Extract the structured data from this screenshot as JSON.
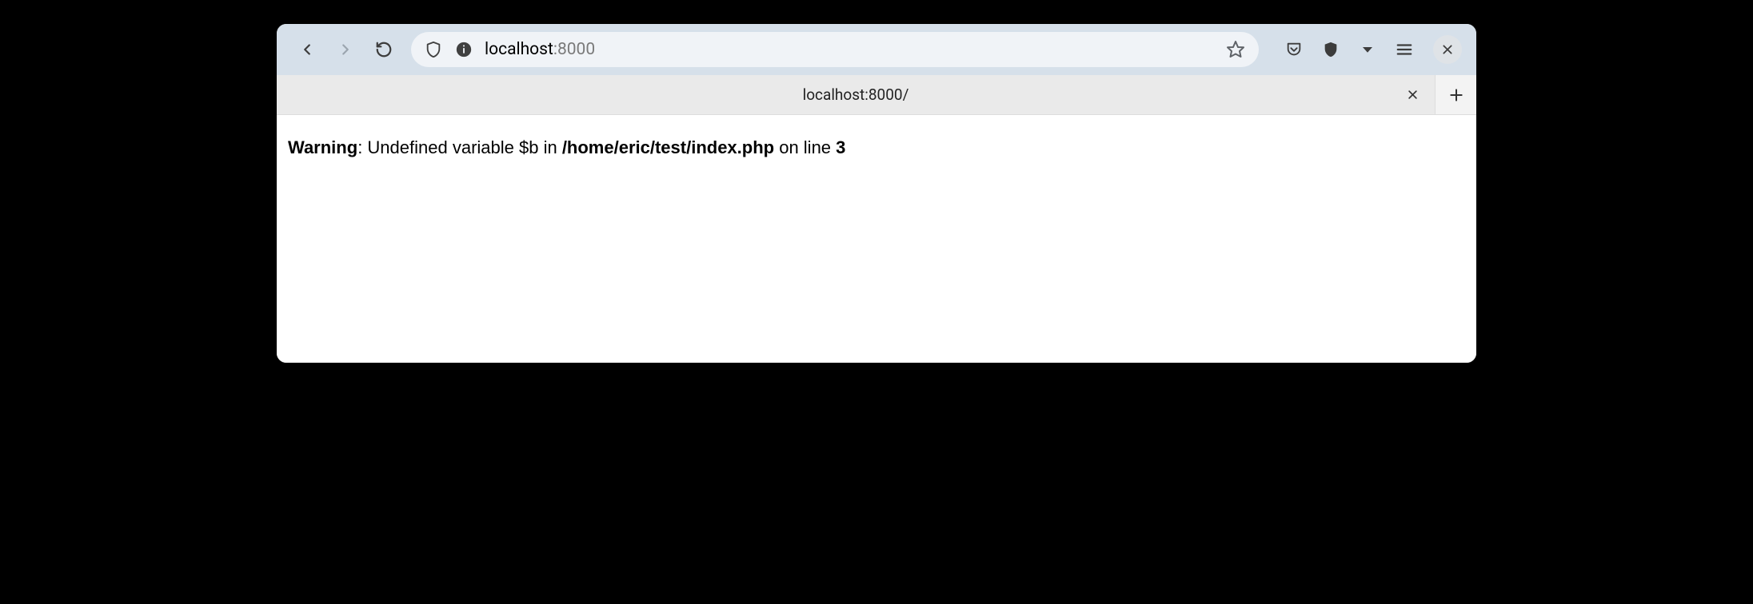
{
  "url": {
    "host": "localhost",
    "port": ":8000"
  },
  "tab": {
    "title": "localhost:8000/"
  },
  "warning": {
    "label": "Warning",
    "colon": ": ",
    "msg1": "Undefined variable $b in ",
    "path": "/home/eric/test/index.php",
    "msg2": " on line ",
    "line": "3"
  }
}
